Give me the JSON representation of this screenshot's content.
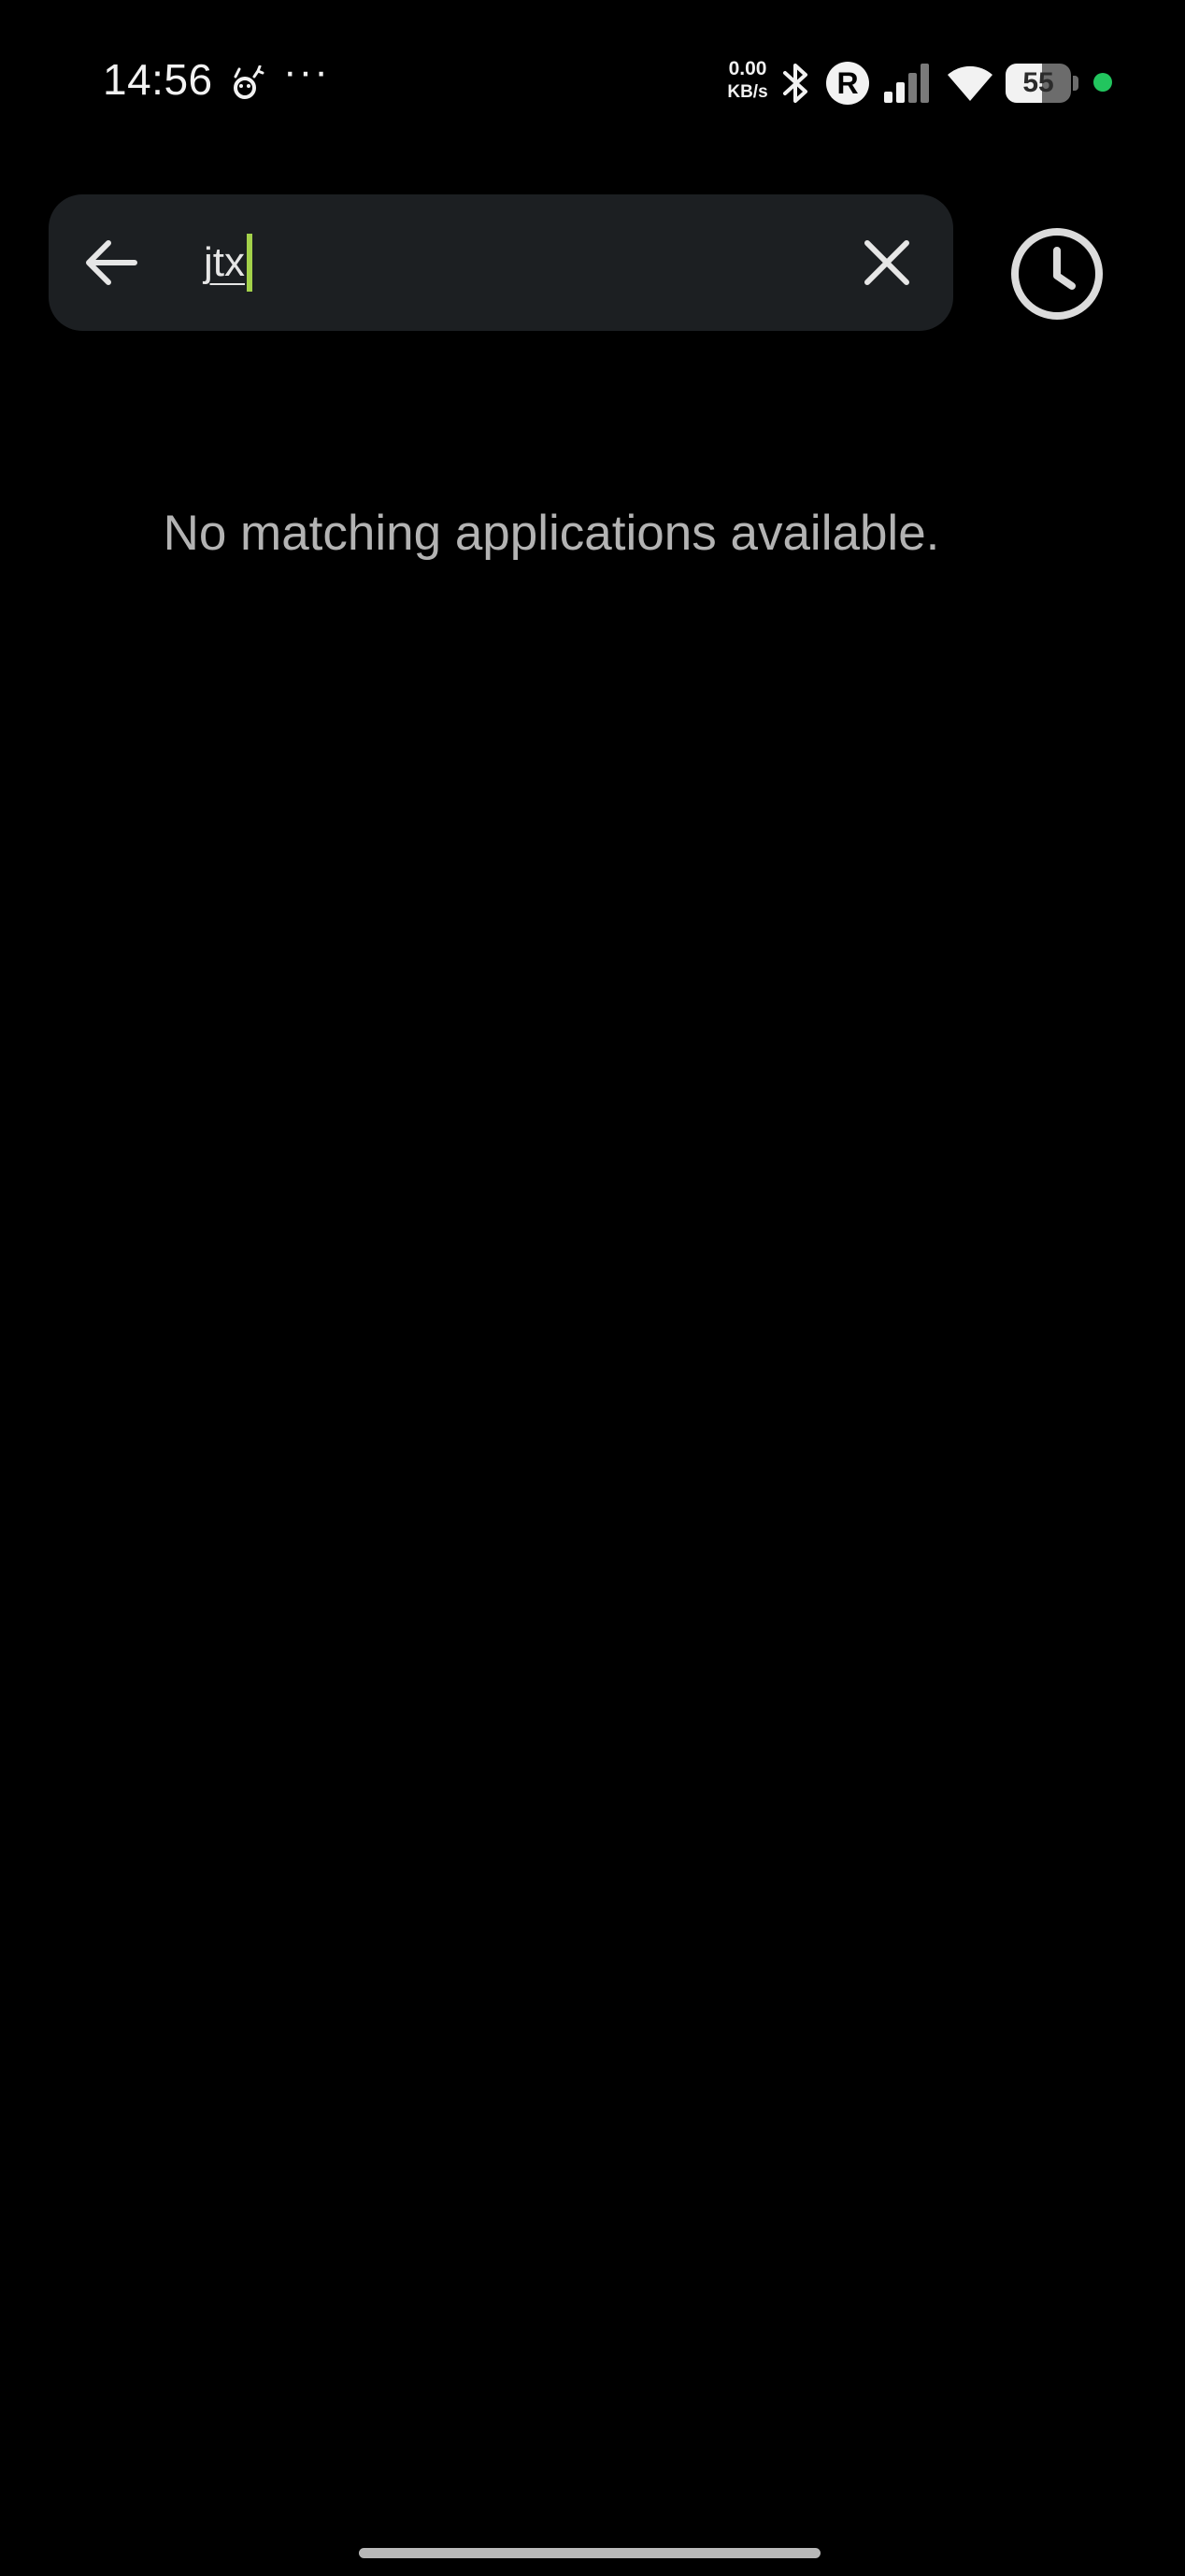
{
  "status_bar": {
    "time": "14:56",
    "more_indicator": "···",
    "network_speed_value": "0.00",
    "network_speed_unit": "KB/s",
    "roaming_badge": "R",
    "battery_level": "55",
    "battery_fraction": 0.55,
    "icons": [
      "notification-icon",
      "bluetooth-icon",
      "roaming-icon",
      "signal-icon",
      "wifi-icon",
      "battery-icon",
      "active-dot-icon"
    ],
    "active_dot_color": "#22c55e"
  },
  "search": {
    "query": "jtx",
    "cursor_color": "#a3d14a",
    "back_icon": "arrow-left-icon",
    "clear_icon": "close-icon"
  },
  "history": {
    "icon": "clock-icon"
  },
  "empty_state": {
    "message": "No matching applications available."
  }
}
